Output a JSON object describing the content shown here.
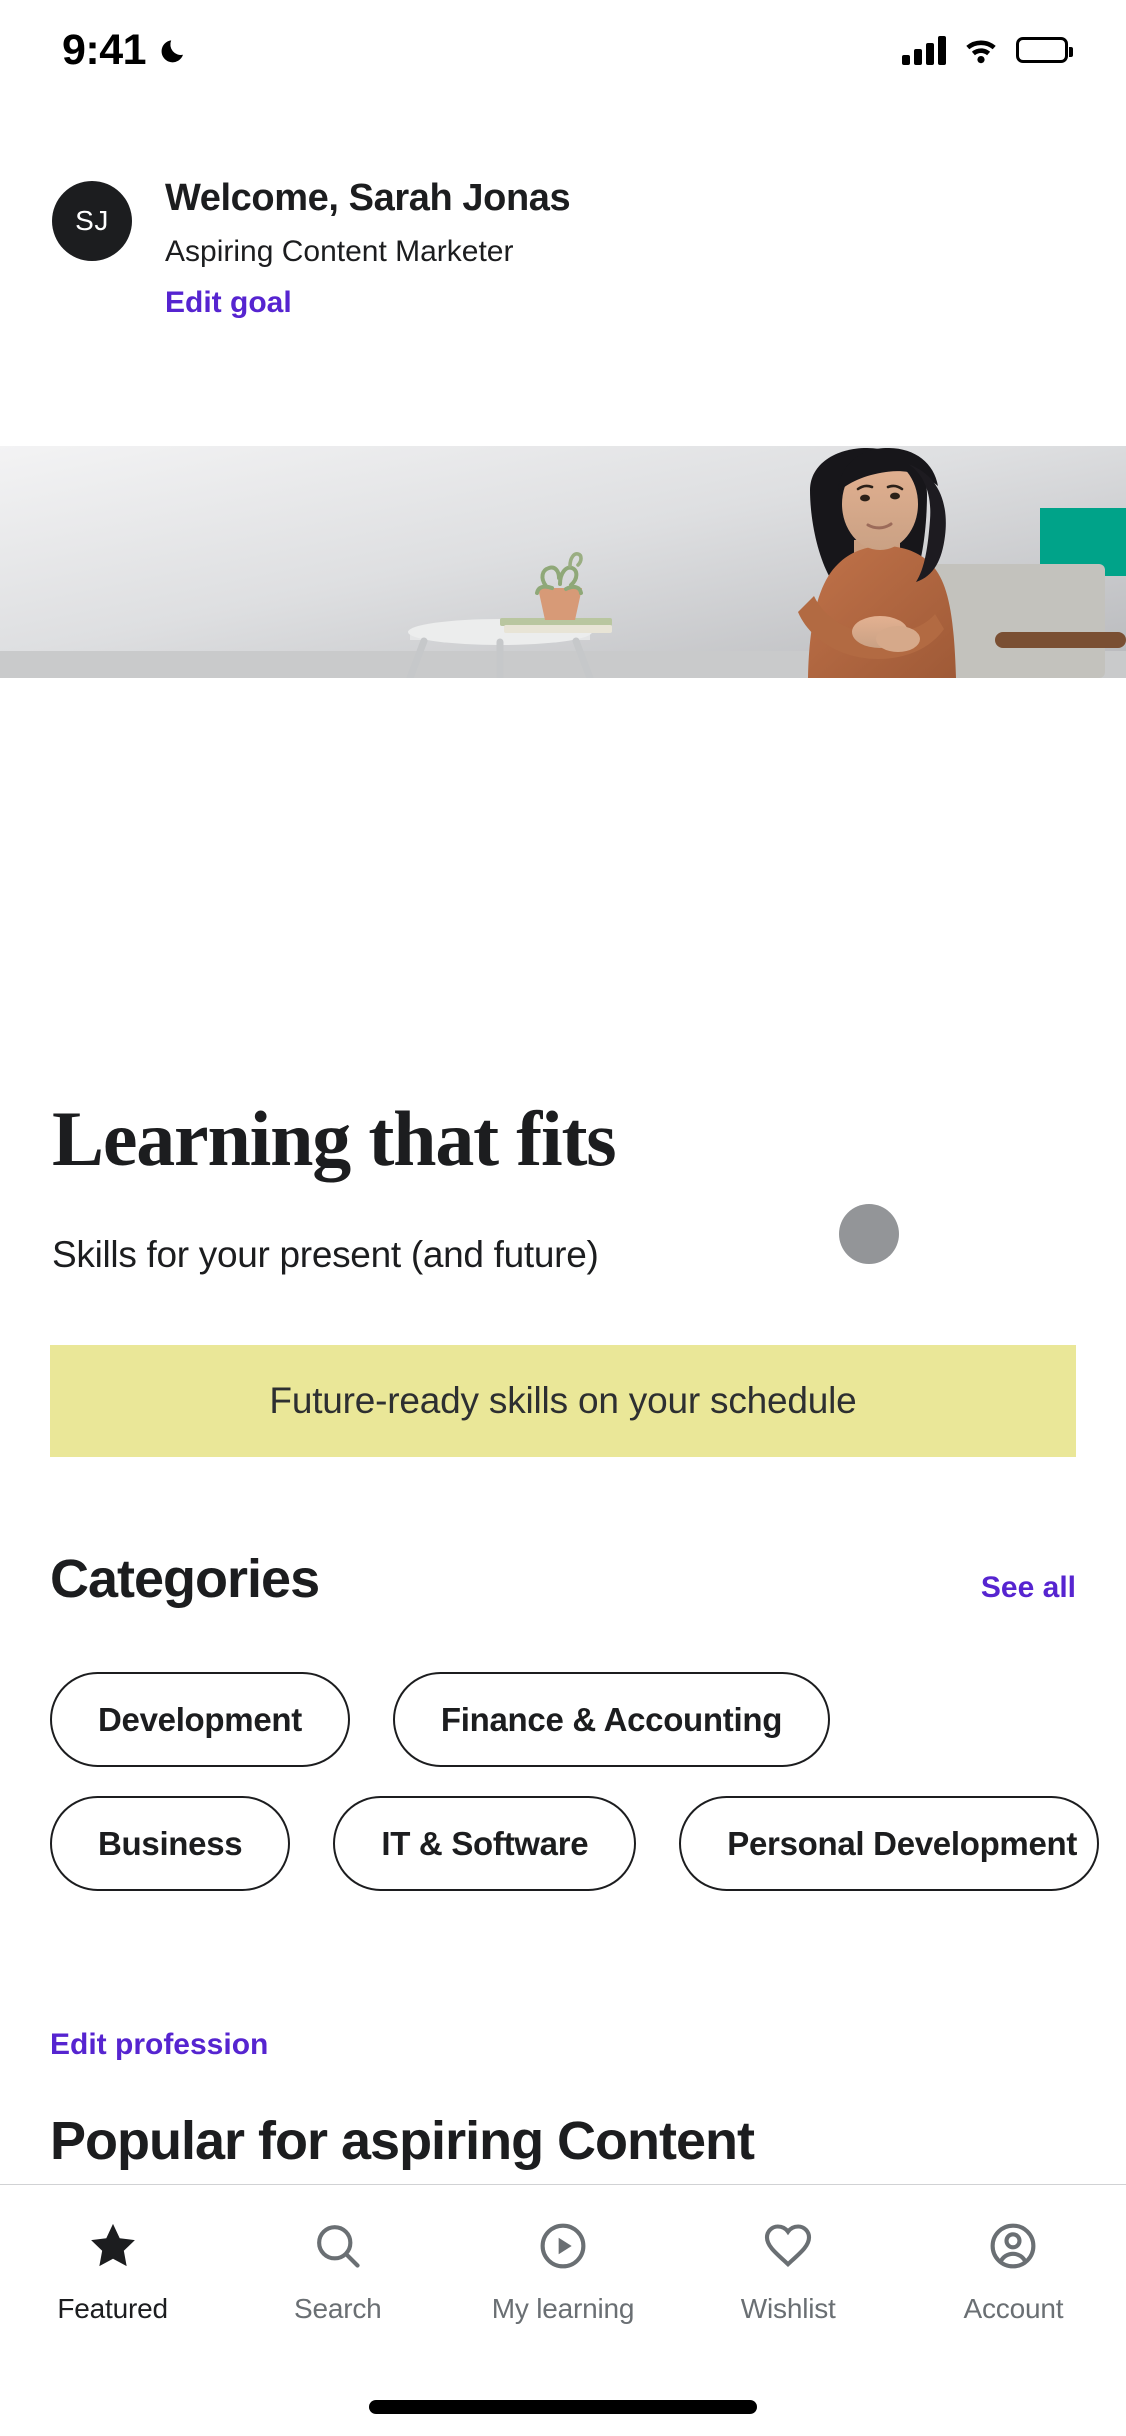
{
  "status_bar": {
    "time": "9:41",
    "dnd_icon": "moon-icon",
    "cellular_icon": "cellular-signal-icon",
    "wifi_icon": "wifi-icon",
    "battery_icon": "battery-full-icon"
  },
  "profile": {
    "avatar_initials": "SJ",
    "welcome_title": "Welcome, Sarah Jonas",
    "subtitle": "Aspiring Content Marketer",
    "edit_goal_label": "Edit goal"
  },
  "hero": {
    "alt": "Smiling woman in rust-colored dress seated beside a side table with plant and books",
    "accent_color": "#00a389",
    "dress_color": "#b5673f",
    "background_color": "#d4d5d8"
  },
  "promo": {
    "headline": "Learning that fits",
    "subheadline": "Skills for your present (and future)",
    "dot_color": "#939598",
    "banner_text": "Future-ready skills on your schedule",
    "banner_color": "#eae798"
  },
  "categories": {
    "title": "Categories",
    "see_all_label": "See all",
    "rows": [
      [
        "Development",
        "Finance & Accounting"
      ],
      [
        "Business",
        "IT & Software",
        "Personal Development"
      ]
    ]
  },
  "profession": {
    "edit_label": "Edit profession",
    "popular_title": "Popular for aspiring Content"
  },
  "tabbar": {
    "items": [
      {
        "label": "Featured",
        "icon": "star-icon",
        "active": true
      },
      {
        "label": "Search",
        "icon": "search-icon",
        "active": false
      },
      {
        "label": "My learning",
        "icon": "play-circle-icon",
        "active": false
      },
      {
        "label": "Wishlist",
        "icon": "heart-icon",
        "active": false
      },
      {
        "label": "Account",
        "icon": "account-circle-icon",
        "active": false
      }
    ]
  },
  "theme": {
    "brand_purple": "#5624d0",
    "text_primary": "#1c1d1f",
    "text_muted": "#6a6f73"
  }
}
